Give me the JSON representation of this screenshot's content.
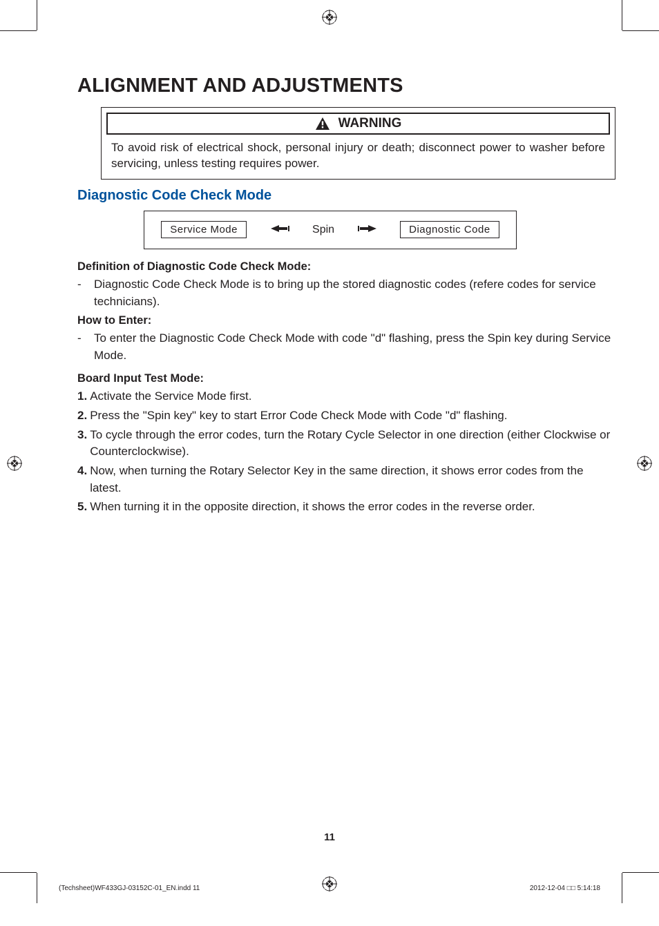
{
  "page_title": "ALIGNMENT AND ADJUSTMENTS",
  "warning": {
    "label": "WARNING",
    "text": "To avoid risk of electrical shock, personal injury or death; disconnect power to washer before servicing, unless testing requires power."
  },
  "section_heading": "Diagnostic Code Check Mode",
  "diagram": {
    "box_left": "Service Mode",
    "center": "Spin",
    "box_right": "Diagnostic  Code"
  },
  "definition": {
    "heading": "Definition of Diagnostic Code Check Mode:",
    "item": "Diagnostic Code Check Mode is to bring up the stored diagnostic codes (refere codes for service technicians)."
  },
  "how_to_enter": {
    "heading": "How to Enter:",
    "item": "To enter the Diagnostic Code Check Mode with code \"d\" flashing, press the Spin key during Service Mode."
  },
  "board_test": {
    "heading": "Board Input Test Mode:",
    "steps": [
      "Activate the Service Mode first.",
      "Press the \"Spin key\" key to start Error Code Check Mode with Code \"d\" flashing.",
      "To cycle through the error codes, turn the Rotary Cycle Selector in one direction (either Clockwise or Counterclockwise).",
      "Now, when turning the Rotary Selector Key in the same direction, it shows error codes from the latest.",
      "When turning it in the opposite direction, it shows the error codes in the reverse order."
    ]
  },
  "page_number": "11",
  "footer": {
    "left": "(Techsheet)WF433GJ-03152C-01_EN.indd   11",
    "right": "2012-12-04   □□ 5:14:18"
  }
}
